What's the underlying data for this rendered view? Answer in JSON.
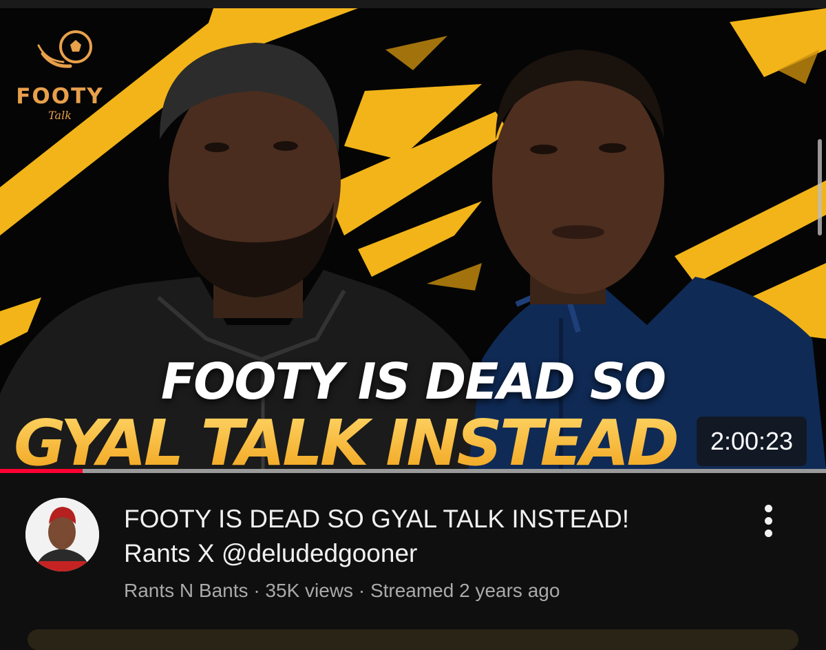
{
  "thumbnail": {
    "brand": {
      "name": "FOOTY",
      "sub": "Talk"
    },
    "headline_line1": "FOOTY IS DEAD SO",
    "headline_line2": "GYAL TALK INSTEAD",
    "duration": "2:00:23",
    "accent_color": "#f4b02c",
    "logo_color": "#e8a04b"
  },
  "progress": {
    "watched_fraction": 0.1,
    "color": "#ff0033"
  },
  "video": {
    "title_line1": "FOOTY IS DEAD SO GYAL TALK INSTEAD!",
    "title_line2": "Rants X @deludedgooner",
    "channel": "Rants N Bants",
    "separator": "·",
    "views": "35K views",
    "streamed": "Streamed 2 years ago"
  },
  "menu": {
    "icon": "more-vert-icon"
  },
  "colors": {
    "background": "#0f0f0f",
    "title": "#f1f1f1",
    "meta": "#aaaaaa"
  }
}
